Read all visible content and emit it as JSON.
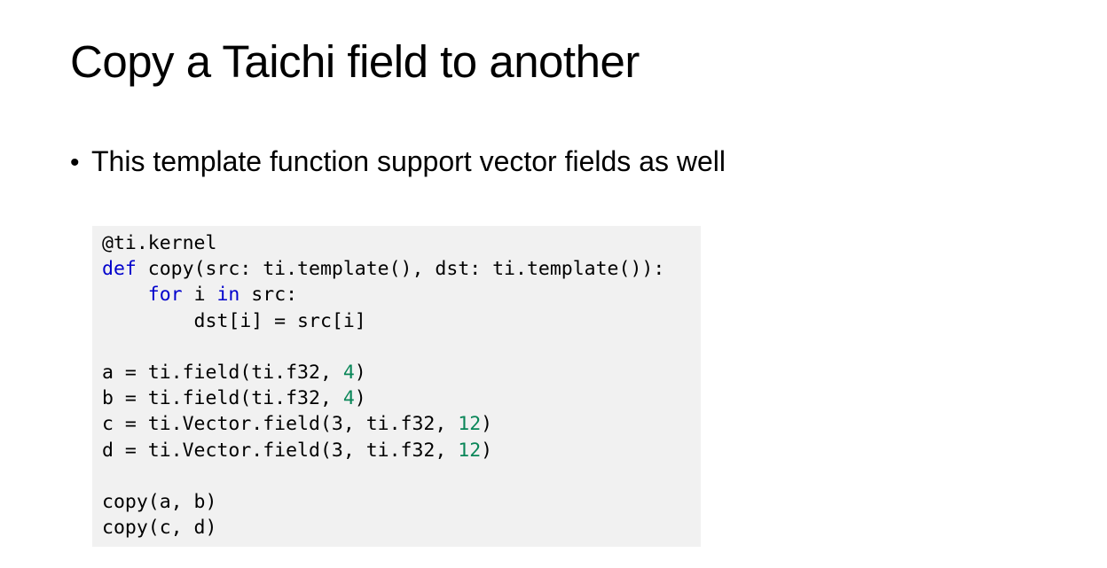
{
  "slide": {
    "title": "Copy a Taichi field to another",
    "bullet_text": "This template function support vector fields as well"
  },
  "code": {
    "lines": [
      [
        {
          "t": "@ti.kernel",
          "c": "plain"
        }
      ],
      [
        {
          "t": "def",
          "c": "kw"
        },
        {
          "t": " copy(src: ti.template(), dst: ti.template()):",
          "c": "plain"
        }
      ],
      [
        {
          "t": "    ",
          "c": "plain"
        },
        {
          "t": "for",
          "c": "kw"
        },
        {
          "t": " i ",
          "c": "plain"
        },
        {
          "t": "in",
          "c": "kw"
        },
        {
          "t": " src:",
          "c": "plain"
        }
      ],
      [
        {
          "t": "        dst[i] = src[i]",
          "c": "plain"
        }
      ],
      [],
      [
        {
          "t": "a = ti.field(ti.f32, ",
          "c": "plain"
        },
        {
          "t": "4",
          "c": "num"
        },
        {
          "t": ")",
          "c": "plain"
        }
      ],
      [
        {
          "t": "b = ti.field(ti.f32, ",
          "c": "plain"
        },
        {
          "t": "4",
          "c": "num"
        },
        {
          "t": ")",
          "c": "plain"
        }
      ],
      [
        {
          "t": "c = ti.Vector.field(3, ti.f32, ",
          "c": "plain"
        },
        {
          "t": "12",
          "c": "num"
        },
        {
          "t": ")",
          "c": "plain"
        }
      ],
      [
        {
          "t": "d = ti.Vector.field(3, ti.f32, ",
          "c": "plain"
        },
        {
          "t": "12",
          "c": "num"
        },
        {
          "t": ")",
          "c": "plain"
        }
      ],
      [],
      [
        {
          "t": "copy(a, b)",
          "c": "plain"
        }
      ],
      [
        {
          "t": "copy(c, d)",
          "c": "plain"
        }
      ]
    ]
  },
  "colors": {
    "keyword": "#0000cc",
    "number": "#098658",
    "code_background": "#f1f1f1"
  }
}
